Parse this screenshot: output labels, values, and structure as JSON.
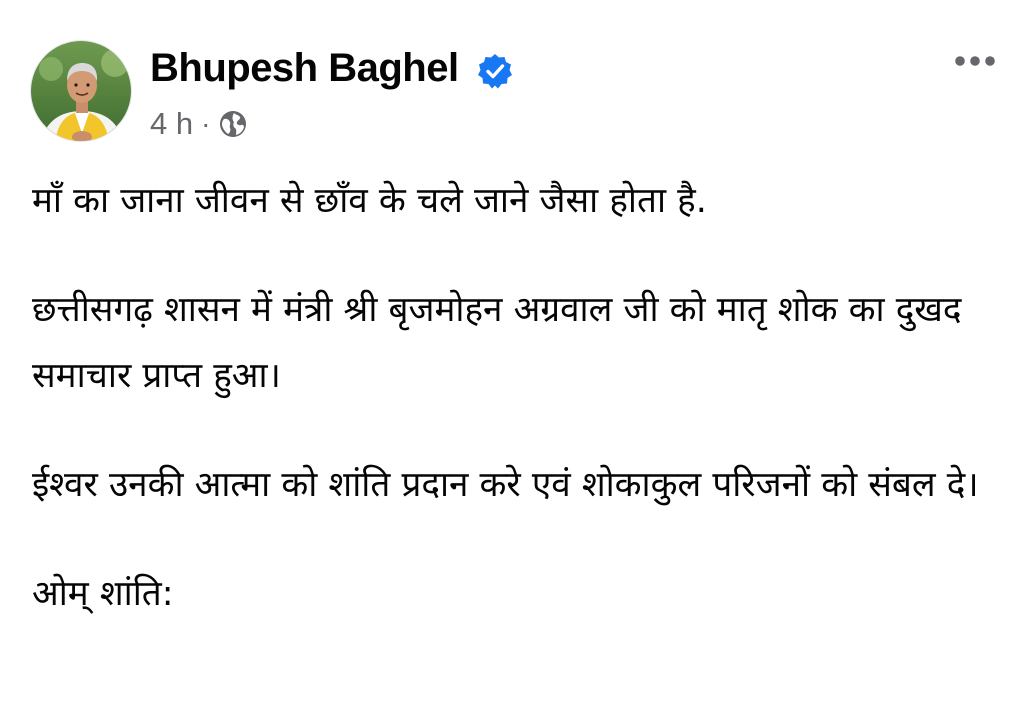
{
  "post": {
    "author": {
      "name": "Bhupesh Baghel",
      "verified": true,
      "avatar_icon": "profile-photo"
    },
    "meta": {
      "time": "4 h",
      "separator": "·",
      "audience_icon": "globe-icon",
      "audience": "public"
    },
    "more_icon": "more-horizontal-icon",
    "paragraphs": [
      "माँ का जाना जीवन से छाँव के चले जाने जैसा होता है.",
      "छत्तीसगढ़ शासन में मंत्री श्री बृजमोहन अग्रवाल जी को मातृ शोक का दुखद समाचार प्राप्त हुआ।",
      "ईश्वर उनकी आत्मा को शांति प्रदान करे एवं शोकाकुल परिजनों को संबल दे।",
      "ओम् शांति:"
    ]
  },
  "colors": {
    "verified_badge": "#1877f2",
    "meta_text": "#65676b",
    "body_text": "#050505",
    "background": "#ffffff"
  }
}
